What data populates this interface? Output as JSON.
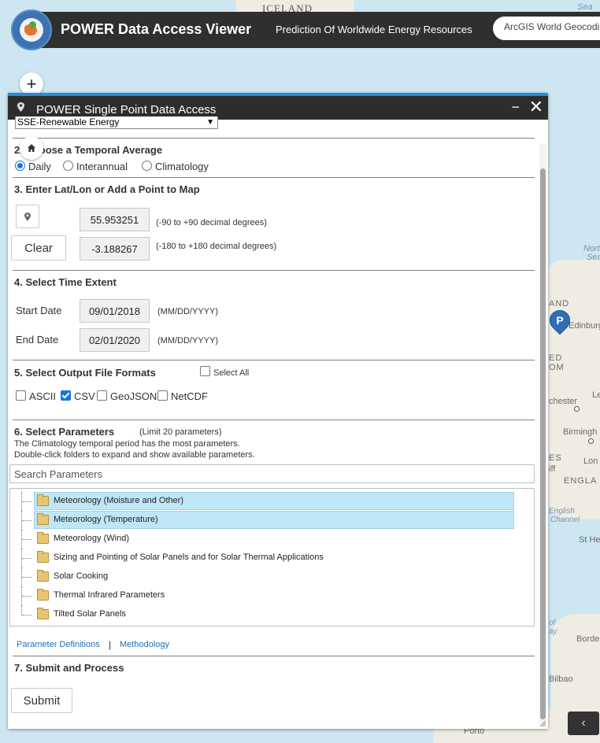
{
  "app": {
    "title": "POWER Data Access Viewer",
    "subtitle": "Prediction Of Worldwide Energy Resources",
    "geocoder_placeholder": "ArcGIS World Geocoding Service"
  },
  "map": {
    "labels": {
      "iceland": "ICELAND",
      "sea_top": "Sea",
      "north_sea_1": "North",
      "north_sea_2": "Sea",
      "scot": "AND",
      "edinburgh": "Edinburgh",
      "ed": "ED",
      "dom": "OM",
      "chester": "chester",
      "birmingham": "Birmingh",
      "les": "ES",
      "iff": "iff",
      "lon": "Lon",
      "england": "ENGLA",
      "english_channel_1": "English",
      "english_channel_2": "Channel",
      "st_he": "St He",
      "of": "of",
      "ay": "ay",
      "borde": "Borde",
      "bilbao": "Bilbao",
      "porto": "Porto",
      "le": "Le"
    },
    "marker_letter": "P",
    "zoom_in": "+"
  },
  "panel": {
    "title": "POWER Single Point Data Access",
    "minimize": "−",
    "close": "✕",
    "dataset": "SSE-Renewable Energy",
    "s2": {
      "title": "2. Choose a Temporal Average",
      "options": [
        {
          "label": "Daily",
          "checked": true
        },
        {
          "label": "Interannual",
          "checked": false
        },
        {
          "label": "Climatology",
          "checked": false
        }
      ]
    },
    "s3": {
      "title": "3. Enter Lat/Lon or Add a Point to Map",
      "lat": "55.953251",
      "lon": "-3.188267",
      "lat_hint": "(-90 to +90 decimal degrees)",
      "lon_hint": "(-180 to +180 decimal degrees)",
      "clear": "Clear"
    },
    "s4": {
      "title": "4. Select Time Extent",
      "start_label": "Start Date",
      "start": "09/01/2018",
      "end_label": "End Date",
      "end": "02/01/2020",
      "format_hint": "(MM/DD/YYYY)"
    },
    "s5": {
      "title": "5. Select Output File Formats",
      "select_all": "Select All",
      "formats": [
        {
          "label": "ASCII",
          "checked": false
        },
        {
          "label": "CSV",
          "checked": true
        },
        {
          "label": "GeoJSON",
          "checked": false
        },
        {
          "label": "NetCDF",
          "checked": false
        }
      ]
    },
    "s6": {
      "title": "6. Select Parameters",
      "limit": "(Limit 20 parameters)",
      "note1": "The Climatology temporal period has the most parameters.",
      "note2": "Double-click folders to expand and show available parameters.",
      "search_placeholder": "Search Parameters",
      "folders": [
        {
          "label": "Meteorology (Moisture and Other)",
          "selected": true
        },
        {
          "label": "Meteorology (Temperature)",
          "selected": true
        },
        {
          "label": "Meteorology (Wind)",
          "selected": false
        },
        {
          "label": "Sizing and Pointing of Solar Panels and for Solar Thermal Applications",
          "selected": false
        },
        {
          "label": "Solar Cooking",
          "selected": false
        },
        {
          "label": "Thermal Infrared Parameters",
          "selected": false
        },
        {
          "label": "Tilted Solar Panels",
          "selected": false
        }
      ],
      "link_definitions": "Parameter Definitions",
      "link_separator": "|",
      "link_methodology": "Methodology"
    },
    "s7": {
      "title": "7. Submit and Process",
      "submit": "Submit"
    }
  },
  "colors": {
    "accent": "#1d8fd8",
    "header_bg": "#2d2d2d",
    "selection": "#bfe6f7",
    "link": "#1f6fb2"
  }
}
